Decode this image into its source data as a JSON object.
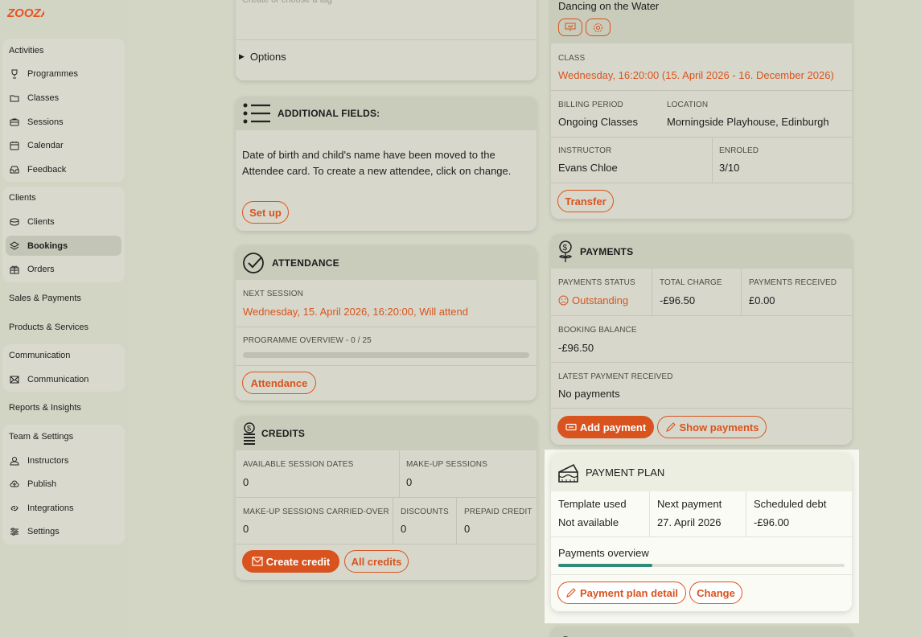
{
  "brand": {
    "logo_text": "ZOOZA",
    "accent": "#d9531e"
  },
  "sidebar": {
    "groups": [
      {
        "title": "Activities",
        "items": [
          {
            "label": "Programmes",
            "icon": "trophy-icon"
          },
          {
            "label": "Classes",
            "icon": "folder-icon"
          },
          {
            "label": "Sessions",
            "icon": "briefcase-icon"
          },
          {
            "label": "Calendar",
            "icon": "calendar-icon"
          },
          {
            "label": "Feedback",
            "icon": "inbox-icon"
          }
        ]
      },
      {
        "title": "Clients",
        "items": [
          {
            "label": "Clients",
            "icon": "coins-icon"
          },
          {
            "label": "Bookings",
            "icon": "layers-icon",
            "active": true
          },
          {
            "label": "Orders",
            "icon": "gift-icon"
          }
        ]
      },
      {
        "title": "Sales & Payments"
      },
      {
        "title": "Products & Services"
      },
      {
        "title": "Communication",
        "items": [
          {
            "label": "Communication",
            "icon": "mail-icon"
          }
        ]
      },
      {
        "title": "Reports & Insights"
      },
      {
        "title": "Team & Settings",
        "items": [
          {
            "label": "Instructors",
            "icon": "user-icon"
          },
          {
            "label": "Publish",
            "icon": "cloud-upload-icon"
          },
          {
            "label": "Integrations",
            "icon": "link-icon"
          },
          {
            "label": "Settings",
            "icon": "sliders-icon"
          }
        ]
      }
    ]
  },
  "tags_card": {
    "placeholder": "Create or choose a tag",
    "options_label": "Options"
  },
  "additional_fields": {
    "title": "ADDITIONAL FIELDS:",
    "text": "Date of birth and child's name have been moved to the Attendee card. To create a new attendee, click on change.",
    "button": "Set up"
  },
  "attendance": {
    "title": "ATTENDANCE",
    "next_session_label": "NEXT SESSION",
    "next_session_value": "Wednesday, 15. April 2026, 16:20:00, Will attend",
    "overview_label": "PROGRAMME OVERVIEW - 0 / 25",
    "overview_progress": 0,
    "button": "Attendance"
  },
  "credits": {
    "title": "CREDITS",
    "available_label": "AVAILABLE SESSION DATES",
    "available_value": "0",
    "makeup_label": "MAKE-UP SESSIONS",
    "makeup_value": "0",
    "carried_label": "MAKE-UP SESSIONS CARRIED-OVER",
    "carried_value": "0",
    "discounts_label": "DISCOUNTS",
    "discounts_value": "0",
    "prepaid_label": "PREPAID CREDIT",
    "prepaid_value": "0",
    "create_button": "Create credit",
    "all_button": "All credits"
  },
  "class_card": {
    "class_name": "Dancing on the Water",
    "class_label": "CLASS",
    "class_value": "Wednesday, 16:20:00 (15. April 2026 - 16. December 2026)",
    "billing_label": "BILLING PERIOD",
    "billing_value": "Ongoing Classes",
    "location_label": "LOCATION",
    "location_value": "Morningside Playhouse, Edinburgh",
    "instructor_label": "INSTRUCTOR",
    "instructor_value": "Evans Chloe",
    "enroled_label": "ENROLED",
    "enroled_value": "3/10",
    "button": "Transfer"
  },
  "payments": {
    "title": "PAYMENTS",
    "status_label": "PAYMENTS STATUS",
    "status_value": "Outstanding",
    "total_label": "TOTAL CHARGE",
    "total_value": "-£96.50",
    "received_label": "PAYMENTS RECEIVED",
    "received_value": "£0.00",
    "balance_label": "BOOKING BALANCE",
    "balance_value": "-£96.50",
    "latest_label": "LATEST PAYMENT RECEIVED",
    "latest_value": "No payments",
    "add_button": "Add payment",
    "show_button": "Show payments"
  },
  "payment_plan": {
    "title": "PAYMENT PLAN",
    "template_label": "Template used",
    "template_value": "Not available",
    "next_label": "Next payment",
    "next_value": "27. April 2026",
    "debt_label": "Scheduled debt",
    "debt_value": "-£96.00",
    "overview_label": "Payments overview",
    "overview_progress": 0.33,
    "detail_button": "Payment plan detail",
    "change_button": "Change"
  }
}
